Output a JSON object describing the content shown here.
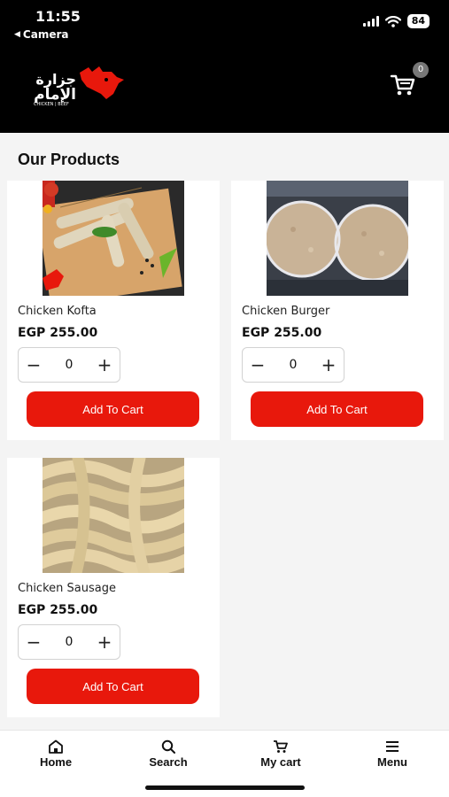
{
  "status_bar": {
    "time": "11:55",
    "back_label": "Camera",
    "battery": "84"
  },
  "header": {
    "logo_text_ar": "جزارة الإمام",
    "logo_sub": "CHICKEN | BEEF",
    "cart_count": "0"
  },
  "page": {
    "section_title": "Our Products"
  },
  "products": [
    {
      "name": "Chicken Kofta",
      "price": "EGP 255.00",
      "quantity": "0",
      "add_label": "Add To Cart"
    },
    {
      "name": "Chicken Burger",
      "price": "EGP 255.00",
      "quantity": "0",
      "add_label": "Add To Cart"
    },
    {
      "name": "Chicken Sausage",
      "price": "EGP 255.00",
      "quantity": "0",
      "add_label": "Add To Cart"
    }
  ],
  "stepper": {
    "minus": "−",
    "plus": "+"
  },
  "bottom_nav": [
    {
      "label": "Home",
      "icon": "home-icon"
    },
    {
      "label": "Search",
      "icon": "search-icon"
    },
    {
      "label": "My cart",
      "icon": "cart-icon"
    },
    {
      "label": "Menu",
      "icon": "menu-icon"
    }
  ],
  "colors": {
    "accent": "#e8180c",
    "header_bg": "#000000"
  }
}
